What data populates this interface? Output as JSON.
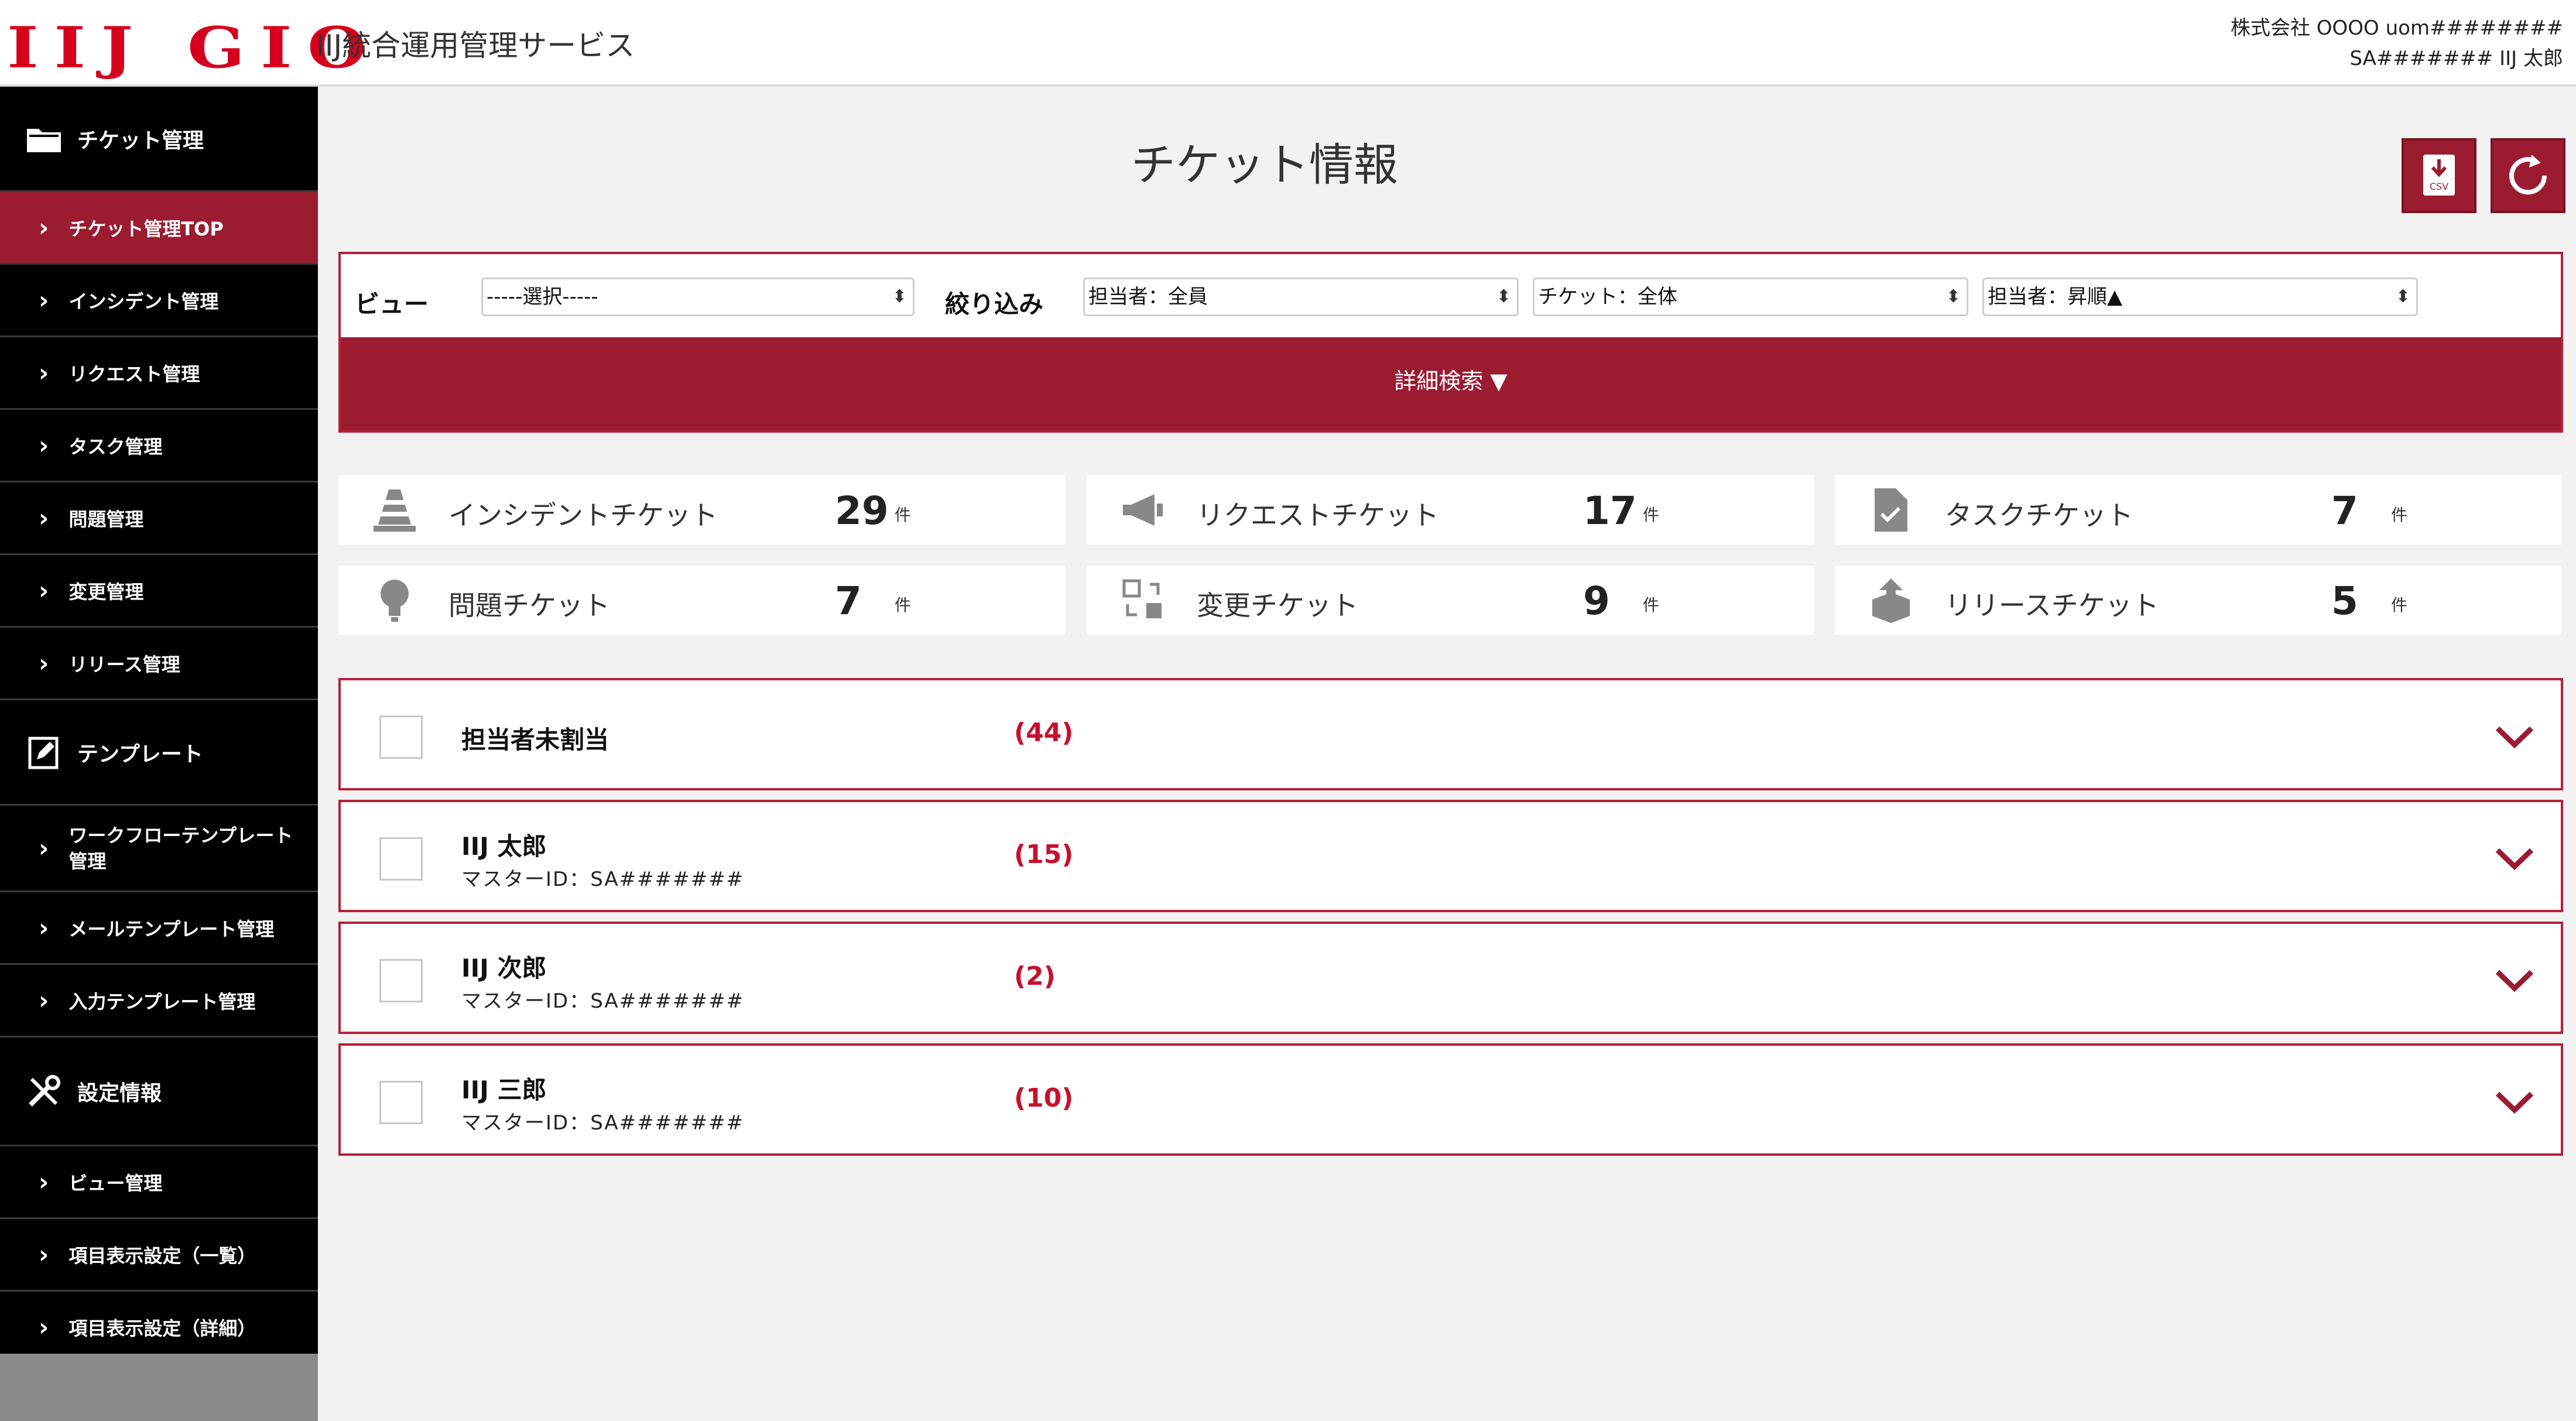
{
  "header": {
    "logo": "IIJ GIO",
    "service_title": "IIJ統合運用管理サービス",
    "account_line1": "株式会社 OOOO uom########",
    "account_line2": "SA####### IIJ 太郎"
  },
  "sidebar": {
    "section1": "チケット管理",
    "section1_items": [
      "チケット管理TOP",
      "インシデント管理",
      "リクエスト管理",
      "タスク管理",
      "問題管理",
      "変更管理",
      "リリース管理"
    ],
    "section2": "テンプレート",
    "section2_items": [
      "ワークフローテンプレート管理",
      "メールテンプレート管理",
      "入力テンプレート管理"
    ],
    "section3": "設定情報",
    "section3_items": [
      "ビュー管理",
      "項目表示設定（一覧）",
      "項目表示設定（詳細）"
    ]
  },
  "main": {
    "title": "チケット情報",
    "csv_icon_text": "CSV",
    "filter": {
      "view_label": "ビュー",
      "view_value": "-----選択-----",
      "narrow_label": "絞り込み",
      "select1": "担当者：全員",
      "select2": "チケット：全体",
      "select3": "担当者：昇順▲",
      "detail_search": "詳細検索 ▼"
    },
    "stats": [
      {
        "label": "インシデントチケット",
        "count": "29",
        "unit": "件"
      },
      {
        "label": "リクエストチケット",
        "count": "17",
        "unit": "件"
      },
      {
        "label": "タスクチケット",
        "count": "7",
        "unit": "件"
      },
      {
        "label": "問題チケット",
        "count": "7",
        "unit": "件"
      },
      {
        "label": "変更チケット",
        "count": "9",
        "unit": "件"
      },
      {
        "label": "リリースチケット",
        "count": "5",
        "unit": "件"
      }
    ],
    "groups": [
      {
        "name": "担当者未割当",
        "sub": "",
        "count": "(44)"
      },
      {
        "name": "IIJ 太郎",
        "sub": "マスターID：SA#######",
        "count": "(15)"
      },
      {
        "name": "IIJ 次郎",
        "sub": "マスターID：SA#######",
        "count": "(2)"
      },
      {
        "name": "IIJ 三郎",
        "sub": "マスターID：SA#######",
        "count": "(10)"
      }
    ]
  },
  "colors": {
    "accent": "#9b1c31",
    "logo": "#d6001c",
    "count_red": "#c8102e"
  }
}
